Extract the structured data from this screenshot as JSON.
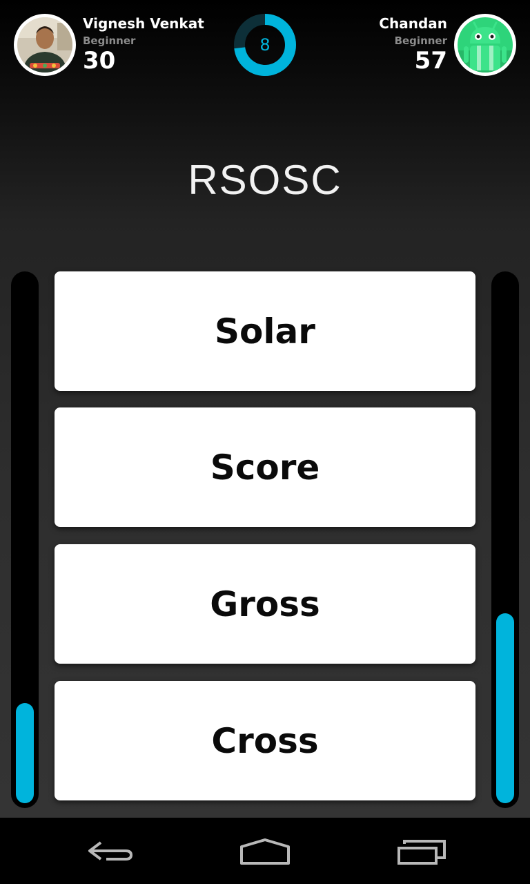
{
  "header": {
    "player1": {
      "name": "Vignesh Venkat",
      "level": "Beginner",
      "score": "30"
    },
    "player2": {
      "name": "Chandan",
      "level": "Beginner",
      "score": "57"
    },
    "timer": {
      "value": "8",
      "remaining_fraction": 0.73
    }
  },
  "question": {
    "clue": "RSOSC"
  },
  "answers": [
    {
      "label": "Solar"
    },
    {
      "label": "Score"
    },
    {
      "label": "Gross"
    },
    {
      "label": "Cross"
    }
  ],
  "progress": {
    "player1_fraction": 0.19,
    "player2_fraction": 0.36
  },
  "colors": {
    "accent": "#00b4dc",
    "card": "#ffffff",
    "track": "#000000"
  },
  "icons": {
    "player1_avatar": "person-photo",
    "player2_avatar": "android-robot-icon",
    "nav_back": "back-arrow-icon",
    "nav_home": "home-icon",
    "nav_recents": "recent-apps-icon"
  }
}
